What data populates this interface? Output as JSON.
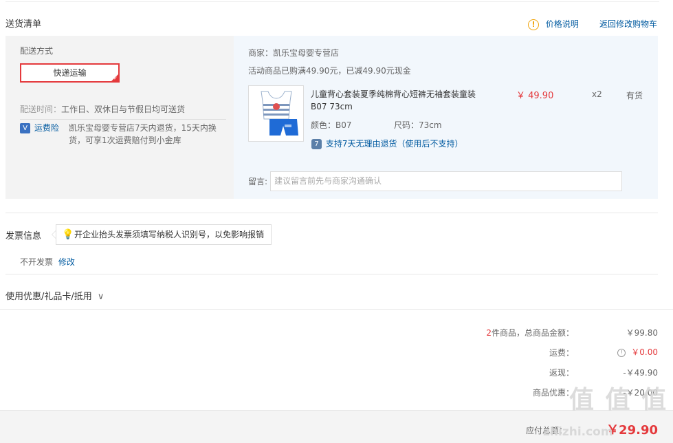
{
  "header": {
    "title": "送货清单",
    "price_note": "价格说明",
    "back_cart": "返回修改购物车"
  },
  "shipping": {
    "method_label": "配送方式",
    "express_button": "快递运输",
    "time_label": "配送时间：",
    "time_value": "工作日、双休日与节假日均可送货",
    "insurance_label": "运费险",
    "insurance_text_line1": "凯乐宝母婴专营店7天内退货，15天内换",
    "insurance_text_line2": "货，可享1次运费赔付到小金库"
  },
  "order": {
    "merchant": "商家：凯乐宝母婴专营店",
    "promo": "活动商品已购满49.90元，已减49.90元现金",
    "product_name_line1": "儿童背心套装夏季纯棉背心短裤无袖套装童装",
    "product_name_line2": "B07 73cm",
    "price": "￥ 49.90",
    "quantity": "x2",
    "stock": "有货",
    "color": "颜色：B07",
    "size": "尺码：73cm",
    "return_policy": "支持7天无理由退货（使用后不支持）",
    "message_label": "留言:",
    "message_placeholder": "建议留言前先与商家沟通确认"
  },
  "invoice": {
    "title": "发票信息",
    "tip": "开企业抬头发票须填写纳税人识别号，以免影响报销",
    "status": "不开发票",
    "edit": "修改"
  },
  "coupons": {
    "title": "使用优惠/礼品卡/抵用"
  },
  "summary": {
    "count": "2",
    "items_label": "件商品，总商品金额：",
    "items_total": "￥99.80",
    "freight_label": "运费：",
    "freight_value": "￥0.00",
    "rebate_label": "返现：",
    "rebate_value": "-￥49.90",
    "discount_label": "商品优惠：",
    "discount_value": "-￥20.00"
  },
  "footer": {
    "total_label": "应付总额：",
    "total_value": "￥29.90",
    "watermark_main": "值 值 值",
    "watermark_url": "zhizhi.com"
  },
  "colors": {
    "accent_red": "#e4393c",
    "link_blue": "#005aa0",
    "warn_orange": "#f0a30a"
  }
}
